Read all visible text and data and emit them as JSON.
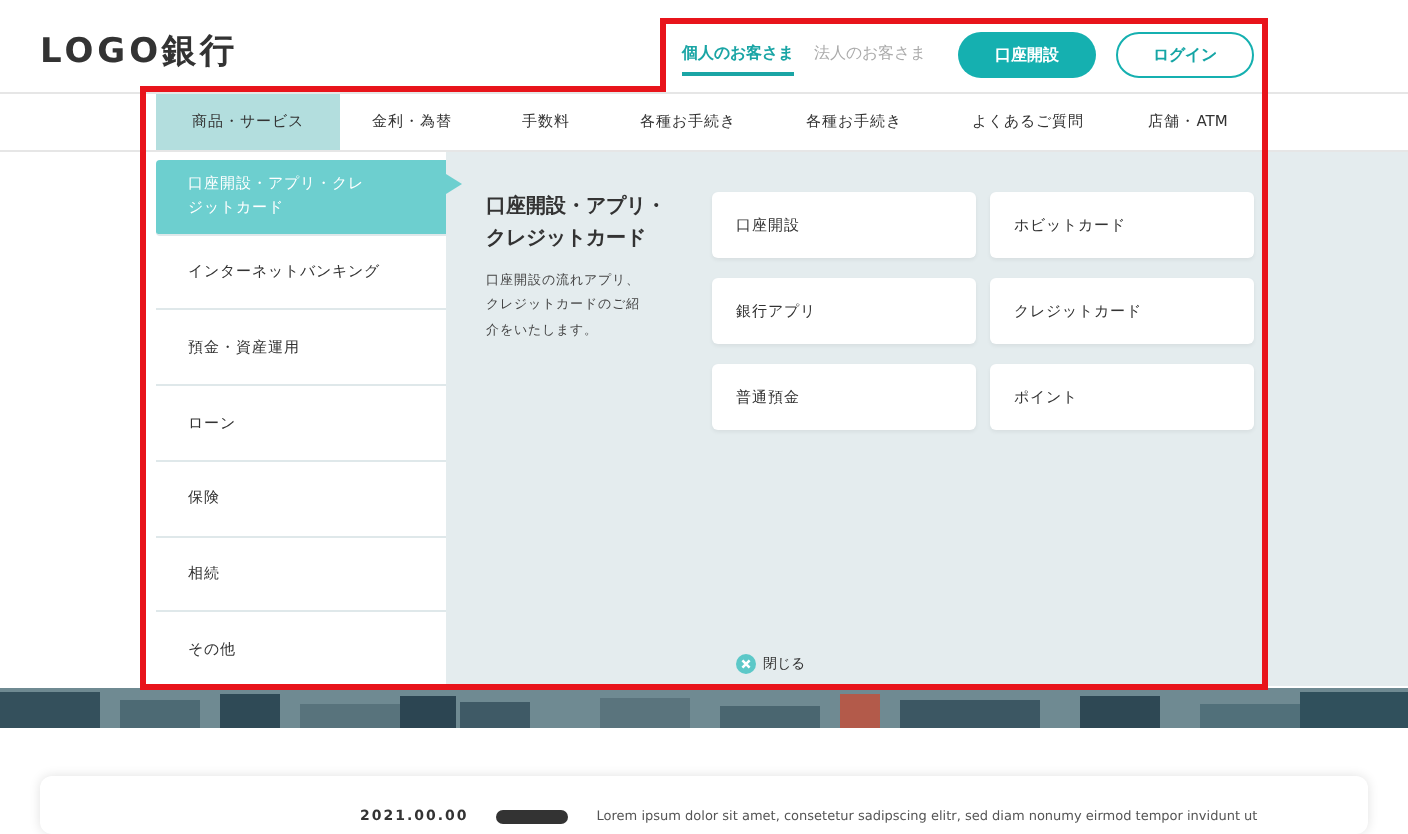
{
  "header": {
    "logo": "LOGO銀行",
    "audience_tabs": [
      {
        "label": "個人のお客さま",
        "selected": true
      },
      {
        "label": "法人のお客さま",
        "selected": false
      }
    ],
    "buttons": [
      {
        "label": "口座開設",
        "kind": "primary"
      },
      {
        "label": "ログイン",
        "kind": "outline"
      }
    ]
  },
  "nav": [
    {
      "label": "商品・サービス",
      "selected": true
    },
    {
      "label": "金利・為替",
      "selected": false
    },
    {
      "label": "手数料",
      "selected": false
    },
    {
      "label": "各種お手続き",
      "selected": false
    },
    {
      "label": "各種お手続き",
      "selected": false
    },
    {
      "label": "よくあるご質問",
      "selected": false
    },
    {
      "label": "店舗・ATM",
      "selected": false
    }
  ],
  "menu": {
    "categories": [
      {
        "label": "口座開設・アプリ・クレジットカード",
        "selected": true
      },
      {
        "label": "インターネットバンキング",
        "selected": false
      },
      {
        "label": "預金・資産運用",
        "selected": false
      },
      {
        "label": "ローン",
        "selected": false
      },
      {
        "label": "保険",
        "selected": false
      },
      {
        "label": "相続",
        "selected": false
      },
      {
        "label": "その他",
        "selected": false
      }
    ],
    "detail": {
      "title": "口座開設・アプリ・クレジットカード",
      "description": "口座開設の流れアプリ、クレジットカードのご紹介をいたします。",
      "links": [
        "口座開設",
        "ホビットカード",
        "銀行アプリ",
        "クレジットカード",
        "普通預金",
        "ポイント"
      ]
    },
    "close": "閉じる"
  },
  "news": {
    "date": "2021.00.00",
    "text": "Lorem ipsum dolor sit amet, consetetur sadipscing elitr, sed diam nonumy eirmod tempor invidunt ut"
  }
}
